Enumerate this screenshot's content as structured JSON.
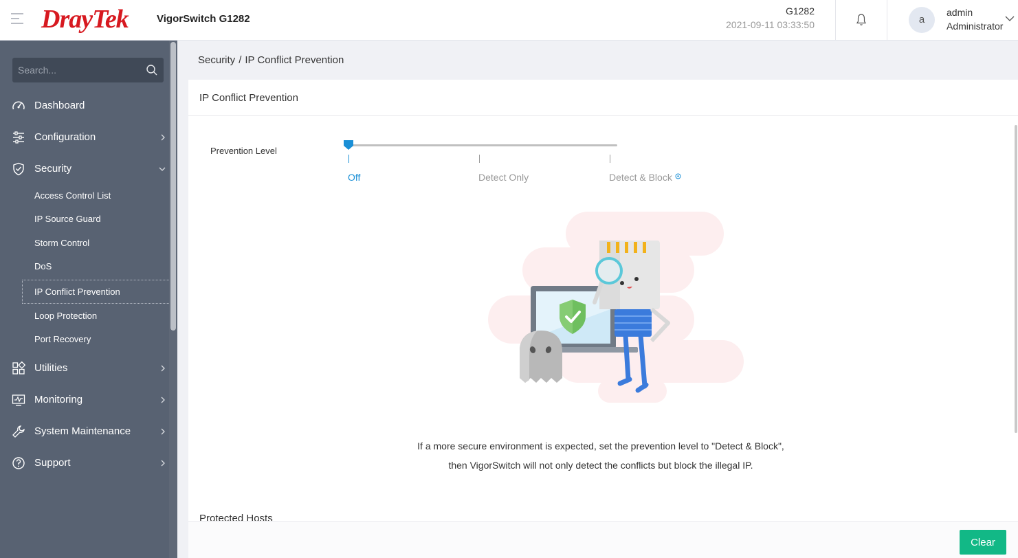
{
  "header": {
    "logo_text": "DrayTek",
    "product": "VigorSwitch G1282",
    "model": "G1282",
    "datetime": "2021-09-11 03:33:50",
    "avatar_letter": "a",
    "user_name": "admin",
    "user_role": "Administrator"
  },
  "sidebar": {
    "search_placeholder": "Search...",
    "items": [
      {
        "label": "Dashboard"
      },
      {
        "label": "Configuration"
      },
      {
        "label": "Security"
      },
      {
        "label": "Utilities"
      },
      {
        "label": "Monitoring"
      },
      {
        "label": "System Maintenance"
      },
      {
        "label": "Support"
      }
    ],
    "security_sub": [
      {
        "label": "Access Control List"
      },
      {
        "label": "IP Source Guard"
      },
      {
        "label": "Storm Control"
      },
      {
        "label": "DoS"
      },
      {
        "label": "IP Conflict Prevention"
      },
      {
        "label": "Loop Protection"
      },
      {
        "label": "Port Recovery"
      }
    ]
  },
  "breadcrumb": {
    "parent": "Security",
    "separator": "/",
    "current": "IP Conflict Prevention"
  },
  "card": {
    "title": "IP Conflict Prevention",
    "prevention_label": "Prevention Level",
    "levels": [
      "Off",
      "Detect Only",
      "Detect & Block"
    ],
    "selected_level": "Off",
    "message_line1": "If a more secure environment is expected, set the prevention level to \"Detect & Block\",",
    "message_line2": "then VigorSwitch will not only detect the conflicts but block the illegal IP.",
    "protected_hosts": "Protected Hosts"
  },
  "footer": {
    "clear_label": "Clear"
  },
  "colors": {
    "brand_red": "#d71920",
    "sidebar_bg": "#586272",
    "accent_blue": "#1a8fd6",
    "button_green": "#12b886"
  }
}
